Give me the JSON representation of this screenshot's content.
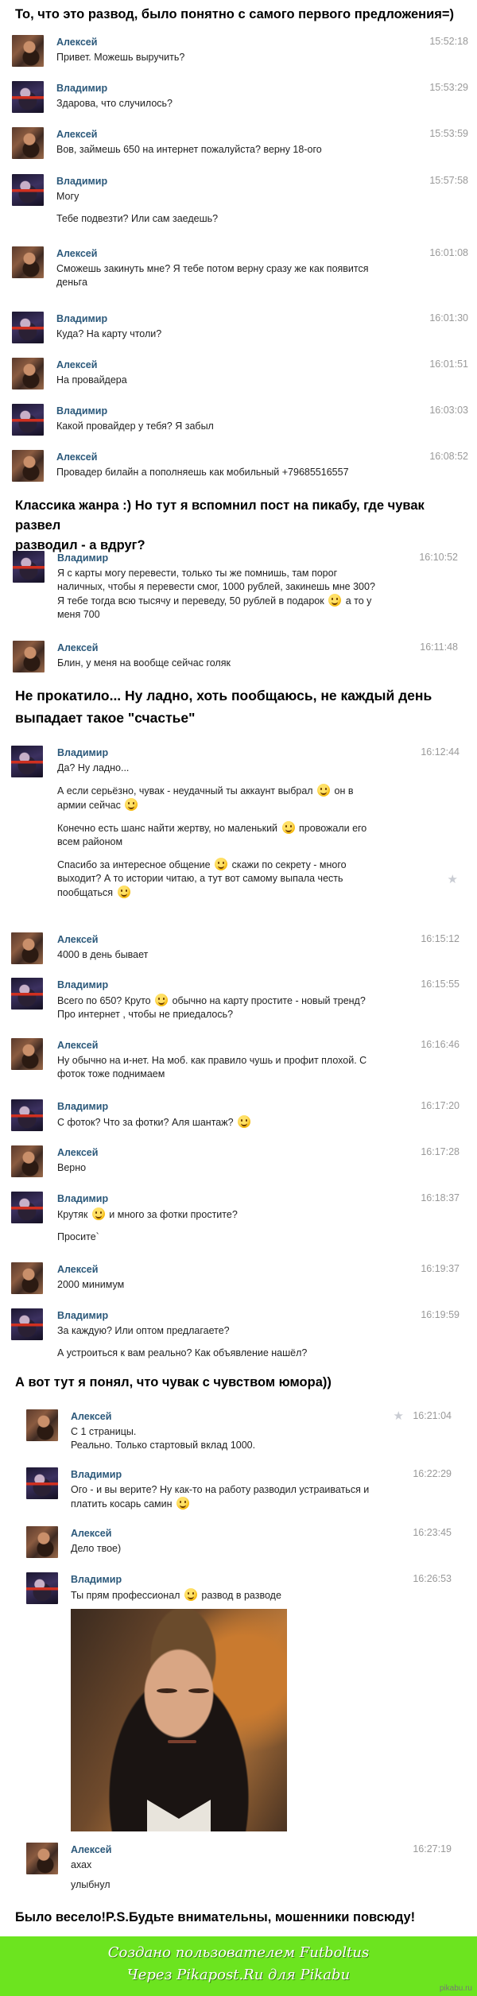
{
  "post": {
    "heading_1": "То, что это развод, было понятно с самого первого предложения=)",
    "heading_2_line1": "Классика жанра :) Но тут я вспомнил пост на пикабу, где чувак развел",
    "heading_2_line2": "разводил - а вдруг?",
    "heading_3_line1": "Не прокатило... Ну ладно, хоть пообщаюсь, не каждый день",
    "heading_3_line2": "выпадает такое \"счастье\"",
    "heading_4": "А вот тут я понял, что чувак с чувством юмора))",
    "heading_5": "Было весело!P.S.Будьте внимательны, мошенники повсюду!"
  },
  "block1": {
    "m1": {
      "sender": "Алексей",
      "time": "15:52:18",
      "t1": "Привет. Можешь выручить?"
    },
    "m2": {
      "sender": "Владимир",
      "time": "15:53:29",
      "t1": "Здарова, что случилось?"
    },
    "m3": {
      "sender": "Алексей",
      "time": "15:53:59",
      "t1": "Вов, займешь 650 на интернет пожалуйста? верну 18-ого"
    },
    "m4": {
      "sender": "Владимир",
      "time": "15:57:58",
      "t1": "Могу",
      "t2": "Тебе подвезти? Или сам заедешь?"
    },
    "m5": {
      "sender": "Алексей",
      "time": "16:01:08",
      "t1": "Сможешь закинуть мне? Я тебе потом верну сразу же как появится",
      "t2": "деньга"
    },
    "m6": {
      "sender": "Владимир",
      "time": "16:01:30",
      "t1": "Куда? На карту чтоли?"
    },
    "m7": {
      "sender": "Алексей",
      "time": "16:01:51",
      "t1": "На провайдера"
    },
    "m8": {
      "sender": "Владимир",
      "time": "16:03:03",
      "t1": "Какой провайдер у тебя? Я забыл"
    },
    "m9": {
      "sender": "Алексей",
      "time": "16:08:52",
      "t1": "Провадер билайн а пополняешь как мобильный +79685516557"
    }
  },
  "block2": {
    "m1": {
      "sender": "Владимир",
      "time": "16:10:52",
      "t1": "Я с карты могу перевести, только ты же помнишь, там порог",
      "t2": "наличных, чтобы я перевести смог, 1000 рублей, закинешь мне 300?",
      "t3a": "Я тебе тогда всю тысячу и переведу, 50 рублей в подарок",
      "t3b": "а то у",
      "t4": "меня 700"
    },
    "m2": {
      "sender": "Алексей",
      "time": "16:11:48",
      "t1": "Блин, у меня на вообще сейчас голяк"
    }
  },
  "block3": {
    "m1": {
      "sender": "Владимир",
      "time": "16:12:44",
      "p1": "Да? Ну ладно...",
      "p2a": "А если серьёзно, чувак - неудачный ты аккаунт выбрал",
      "p2b": "он в",
      "p2c": "армии сейчас",
      "p3a": "Конечно есть шанс найти жертву, но маленький",
      "p3b": "провожали его",
      "p3c": "всем районом",
      "p4a": "Спасибо за интересное общение",
      "p4b": "скажи по секрету - много",
      "p4c": "выходит? А то истории читаю, а тут вот самому выпала честь",
      "p4d": "пообщаться"
    },
    "m2": {
      "sender": "Алексей",
      "time": "16:15:12",
      "t1": "4000 в день бывает"
    },
    "m3": {
      "sender": "Владимир",
      "time": "16:15:55",
      "t1a": "Всего по 650? Круто",
      "t1b": "обычно на карту простите - новый тренд?",
      "t2": "Про интернет , чтобы не приедалось?"
    },
    "m4": {
      "sender": "Алексей",
      "time": "16:16:46",
      "t1": "Ну обычно на и-нет. На моб. как правило чушь и профит плохой. С",
      "t2": "фоток тоже поднимаем"
    },
    "m5": {
      "sender": "Владимир",
      "time": "16:17:20",
      "t1": "С фоток? Что за фотки? Аля шантаж?"
    },
    "m6": {
      "sender": "Алексей",
      "time": "16:17:28",
      "t1": "Верно"
    },
    "m7": {
      "sender": "Владимир",
      "time": "16:18:37",
      "t1a": "Крутяк",
      "t1b": "и много за фотки простите?",
      "t2": "Просите`"
    },
    "m8": {
      "sender": "Алексей",
      "time": "16:19:37",
      "t1": "2000 минимум"
    },
    "m9": {
      "sender": "Владимир",
      "time": "16:19:59",
      "t1": "За каждую? Или оптом предлагаете?",
      "t2": "А устроиться к вам реально? Как объявление нашёл?"
    }
  },
  "block4": {
    "m1": {
      "sender": "Алексей",
      "time": "16:21:04",
      "t1": "С 1 страницы.",
      "t2": "Реально. Только стартовый вклад 1000."
    },
    "m2": {
      "sender": "Владимир",
      "time": "16:22:29",
      "t1": "Ого - и вы верите? Ну как-то на работу разводил устраиваться и",
      "t2": "платить косарь самин"
    },
    "m3": {
      "sender": "Алексей",
      "time": "16:23:45",
      "t1": "Дело твое)"
    },
    "m4": {
      "sender": "Владимир",
      "time": "16:26:53",
      "t1a": "Ты прям профессионал",
      "t1b": "развод в разводе"
    },
    "m5": {
      "sender": "Алексей",
      "time": "16:27:19",
      "t1": "ахах",
      "t2": "улыбнул"
    }
  },
  "footer": {
    "line1": "Создано пользователем Futboltus",
    "line2": "Через Pikapost.Ru для Pikabu",
    "watermark": "pikabu.ru",
    "color": "#6ce41f"
  },
  "colors": {
    "sender": "#2b587a",
    "time": "#999999",
    "text": "#222222"
  }
}
